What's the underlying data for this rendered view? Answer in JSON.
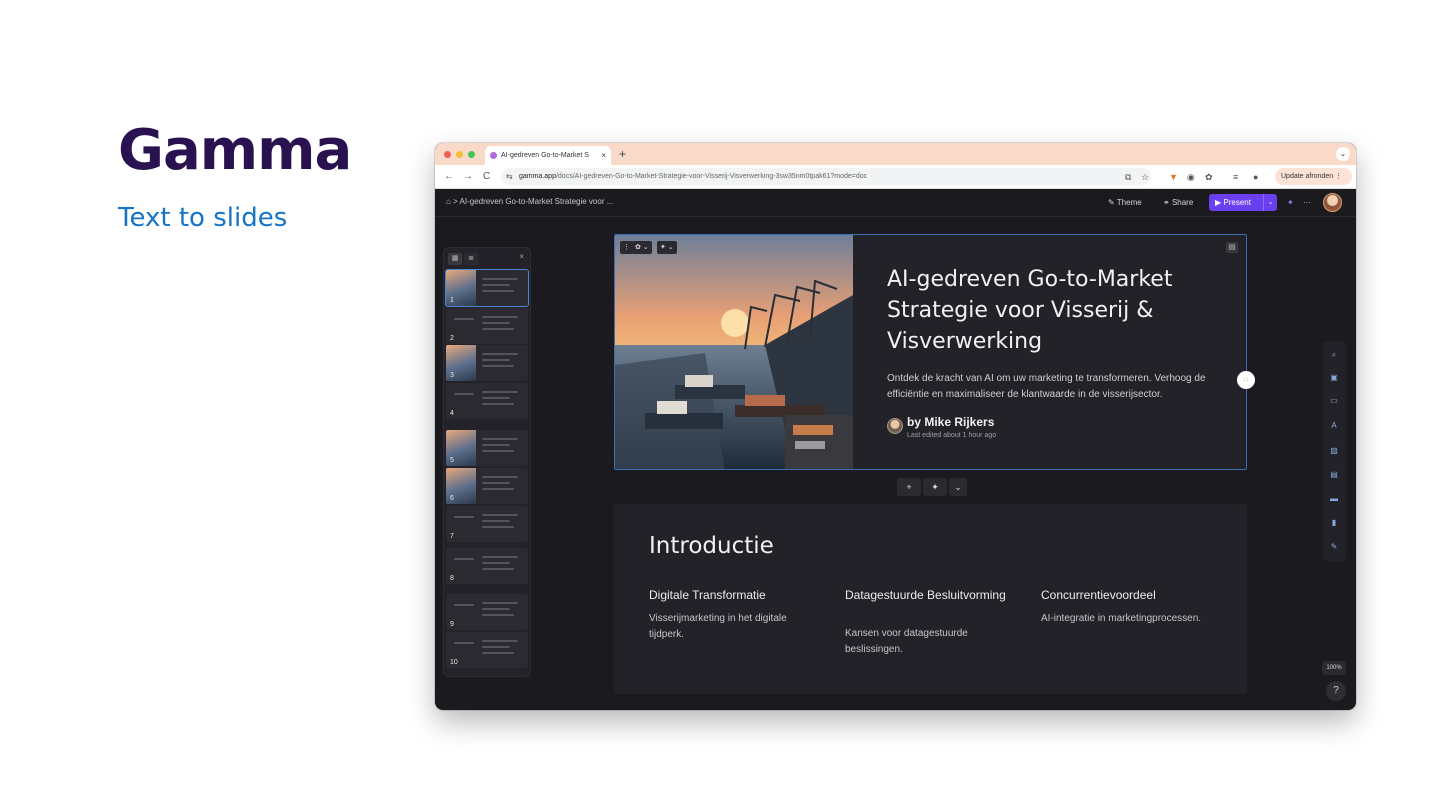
{
  "hero": {
    "title": "Gamma",
    "subtitle": "Text to slides"
  },
  "browser": {
    "tab_title": "AI-gedreven Go-to-Market S",
    "tab_close": "×",
    "new_tab": "+",
    "tab_menu": "⌄",
    "back": "←",
    "forward": "→",
    "reload": "C",
    "url_host": "gamma.app",
    "url_path": "/docs/AI-gedreven-Go-to-Market-Strategie-voor-Visserij-Visverwerking-3sw35nm0tpak61?mode=doc",
    "update_button": "Update afronden  ⋮"
  },
  "app": {
    "home_icon": "⌂",
    "breadcrumb": ">   AI-gedreven Go-to-Market Strategie voor ...",
    "theme_label": "Theme",
    "share_label": "Share",
    "present_label": "▶  Present",
    "present_caret": "⌄",
    "more": "···",
    "sparkle": "✦"
  },
  "thumbnails": {
    "close": "×",
    "items": [
      {
        "num": "1"
      },
      {
        "num": "2"
      },
      {
        "num": "3"
      },
      {
        "num": "4"
      },
      {
        "num": "5"
      },
      {
        "num": "6"
      },
      {
        "num": "7"
      },
      {
        "num": "8"
      },
      {
        "num": "9"
      },
      {
        "num": "10"
      }
    ]
  },
  "slide1": {
    "title": "AI-gedreven Go-to-Market Strategie voor Visserij & Visverwerking",
    "description": "Ontdek de kracht van AI om uw marketing te transformeren. Verhoog de efficiëntie en maximaliseer de klantwaarde in de visserijsector.",
    "author": "by Mike Rijkers",
    "edited": "Last edited about 1 hour ago"
  },
  "slide_controls": {
    "add": "+",
    "ai": "✦",
    "more": "⌄"
  },
  "slide2": {
    "title": "Introductie",
    "columns": [
      {
        "title": "Digitale Transformatie",
        "desc": "Visserijmarketing in het digitale tijdperk."
      },
      {
        "title": "Datagestuurde Besluitvorming",
        "desc": "Kansen voor datagestuurde beslissingen."
      },
      {
        "title": "Concurrentievoordeel",
        "desc": "AI-integratie in marketingprocessen."
      }
    ]
  },
  "zoom": "100%",
  "help": "?",
  "colors": {
    "accent": "#6a3ff0",
    "hero_title": "#2a1250",
    "hero_subtitle": "#1674c4",
    "app_bg": "#1b1a1e",
    "card_bg": "#232228"
  }
}
